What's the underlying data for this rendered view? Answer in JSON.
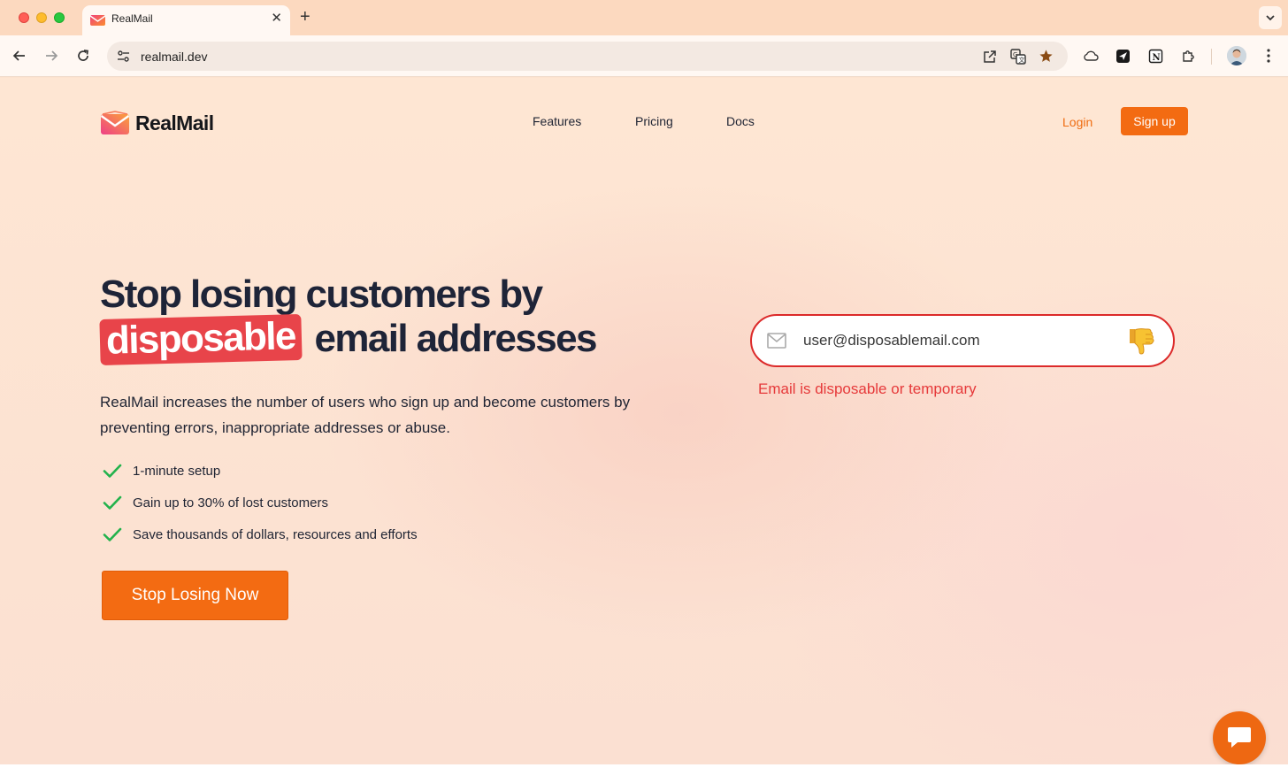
{
  "browser": {
    "tab_title": "RealMail",
    "tab_close": "✕",
    "new_tab": "+",
    "url": "realmail.dev"
  },
  "header": {
    "brand": "RealMail",
    "nav": [
      {
        "label": "Features"
      },
      {
        "label": "Pricing"
      },
      {
        "label": "Docs"
      }
    ],
    "login": "Login",
    "signup": "Sign up"
  },
  "hero": {
    "headline_line1": "Stop losing customers by",
    "headline_highlight": "disposable",
    "headline_line2_rest": "email addresses",
    "lead": "RealMail increases the number of users who sign up and become customers by preventing errors, inappropriate addresses or abuse.",
    "bullets": [
      "1-minute setup",
      "Gain up to 30% of lost customers",
      "Save thousands of dollars, resources and efforts"
    ],
    "cta": "Stop Losing Now"
  },
  "demo": {
    "email_value": "user@disposablemail.com",
    "error": "Email is disposable or temporary",
    "result_icon": "thumbs-down-icon"
  },
  "colors": {
    "accent": "#f36b12",
    "error": "#dc2a2a",
    "highlight": "#e8444a",
    "check": "#22b24c"
  }
}
